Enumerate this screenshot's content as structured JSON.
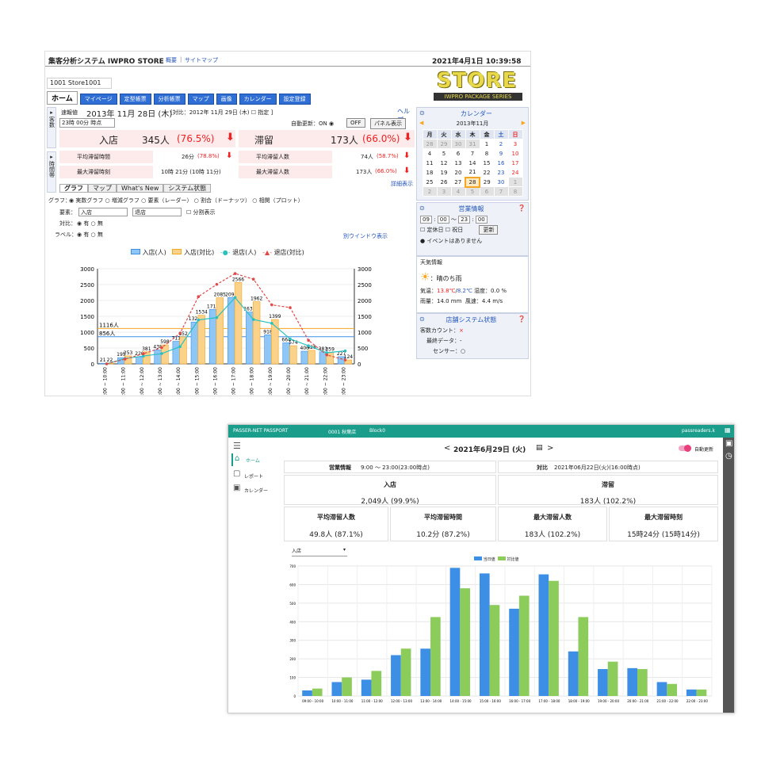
{
  "top": {
    "app_title": "集客分析システム IWPRO STORE",
    "link_overview": "概要",
    "link_sitemap": "サイトマップ",
    "datetime": "2021年4月1日 10:39:58",
    "logo_main": "STORE",
    "logo_sub": "IWPRO PACKAGE SERIES",
    "store_select": "1001 Store1001",
    "tabs": [
      "ホーム",
      "マイページ",
      "定型帳票",
      "分析帳票",
      "マップ",
      "画像",
      "カレンダー",
      "設定登録"
    ],
    "side_label_1": "客数",
    "side_label_2": "時間帯",
    "latest_label": "速報値",
    "date": "2013年 11月 28日 (木)",
    "compare": "[対比：2012年 11月 29日 (木) ☐ 指定 ]",
    "help": "ヘルプ",
    "time_select": "23時 00分 時点",
    "auto_update": "自動更新：ON ◉",
    "off_btn": "OFF",
    "panel_btn": "パネル表示",
    "entry_label": "入店",
    "entry_value": "345人",
    "entry_pct": "(76.5%)",
    "stay_label": "滞留",
    "stay_value": "173人",
    "stay_pct": "(66.0%)",
    "avg_stay_time_label": "平均滞留時間",
    "avg_stay_time": "26分",
    "avg_stay_time_pct": "(78.8%)",
    "avg_stay_count_label": "平均滞留人数",
    "avg_stay_count": "74人",
    "avg_stay_count_pct": "(58.7%)",
    "max_stay_time_label": "最大滞留時刻",
    "max_stay_time": "10時 21分 (10時 11分)",
    "max_stay_count_label": "最大滞留人数",
    "max_stay_count": "173人",
    "max_stay_count_pct": "(66.0%)",
    "detail_link": "詳細表示",
    "subtabs": [
      "グラフ",
      "マップ",
      "What's New",
      "システム状態"
    ],
    "graph_label": "グラフ：",
    "graph_options": "◉ 実数グラフ ○ 増減グラフ ○ 要素（レーダー） ○ 割合（ドーナッツ） ○ 相関（プロット）",
    "element_label": "要素：",
    "element_1": "入店",
    "element_2": "退店",
    "split_label": "☐ 分割表示",
    "compare_label": "対比：",
    "compare_options": "◉ 有 ○ 無",
    "label_label": "ラベル：",
    "label_options": "◉ 有 ○ 無",
    "new_window": "別ウインドウ表示",
    "calendar_title": "カレンダー",
    "calendar_month": "2013年11月",
    "calendar_days": [
      "月",
      "火",
      "水",
      "木",
      "金",
      "土",
      "日"
    ],
    "calendar_rows": [
      [
        "28",
        "29",
        "30",
        "31",
        "1",
        "2",
        "3"
      ],
      [
        "4",
        "5",
        "6",
        "7",
        "8",
        "9",
        "10"
      ],
      [
        "11",
        "12",
        "13",
        "14",
        "15",
        "16",
        "17"
      ],
      [
        "18",
        "19",
        "20",
        "21",
        "22",
        "23",
        "24"
      ],
      [
        "25",
        "26",
        "27",
        "28",
        "29",
        "30",
        "1"
      ],
      [
        "2",
        "3",
        "4",
        "5",
        "6",
        "7",
        "8"
      ]
    ],
    "biz_title": "営業情報",
    "biz_h1": "09",
    "biz_m1": "00",
    "biz_h2": "23",
    "biz_m2": "00",
    "holiday_label": "☐ 定休日 ☐ 祝日",
    "update_btn": "更新",
    "no_event": "● イベントはありません",
    "weather_title": "天気情報",
    "weather_desc": "：晴のち雨",
    "temp_label": "気温：",
    "temp_high": "13.8℃",
    "temp_low": "8.2℃",
    "humidity": "湿度：0.0 %",
    "rain": "雨量：14.0 mm",
    "wind": "風速：4.4 m/s",
    "sys_title": "店舗システム状態",
    "sys_count": "客数カウント：",
    "sys_count_val": "×",
    "sys_latest": "最終データ：-",
    "sys_sensor": "センサー：○"
  },
  "bottom": {
    "app_name": "PASSER-NET PASSPORT",
    "store": "0001 秋葉店",
    "block": "Block0",
    "user": "passreaders.k",
    "nav": [
      "ホーム",
      "レポート",
      "カレンダー"
    ],
    "date": "2021年6月29日 (火)",
    "auto_update": "自動更新",
    "biz_label": "営業情報",
    "biz_value": "9:00 ～ 23:00(23:00時点)",
    "compare_label": "対比",
    "compare_value": "2021年06月22日(火)(16:00時点)",
    "entry_label": "入店",
    "entry_value": "2,049人 (99.9%)",
    "stay_label": "滞留",
    "stay_value": "183人 (102.2%)",
    "avg_count_label": "平均滞留人数",
    "avg_count_value": "49.8人 (87.1%)",
    "avg_time_label": "平均滞留時間",
    "avg_time_value": "10.2分 (87.2%)",
    "max_count_label": "最大滞留人数",
    "max_count_value": "183人 (102.2%)",
    "max_time_label": "最大滞留時刻",
    "max_time_value": "15時24分 (15時14分)",
    "select_value": "入店"
  },
  "colors": {
    "blue": "#3d8fe6",
    "orange": "#f5a623",
    "teal": "#2ac0c0",
    "redline": "#e24848",
    "green": "#8bcc5b",
    "header": "#1b9d8c"
  },
  "chart_data": [
    {
      "type": "bar",
      "x": [
        "09:00 ~ 10:00",
        "10:00 ~ 11:00",
        "11:00 ~ 12:00",
        "12:00 ~ 13:00",
        "13:00 ~ 14:00",
        "14:00 ~ 15:00",
        "15:00 ~ 16:00",
        "16:00 ~ 17:00",
        "17:00 ~ 18:00",
        "18:00 ~ 19:00",
        "19:00 ~ 20:00",
        "20:00 ~ 21:00",
        "21:00 ~ 22:00",
        "22:00 ~ 23:00"
      ],
      "ylim": [
        0,
        3000
      ],
      "y_ticks": [
        0,
        500,
        1000,
        1500,
        2000,
        2500,
        3000
      ],
      "series": [
        {
          "name": "入店(人)",
          "type": "bar",
          "values": [
            21,
            195,
            220,
            438,
            711,
            1320,
            1715,
            2091,
            1635,
            918,
            664,
            400,
            381,
            227
          ]
        },
        {
          "name": "入店(対比)",
          "type": "bar",
          "values": [
            22,
            253,
            381,
            598,
            852,
            1534,
            2085,
            2566,
            1962,
            1399,
            574,
            428,
            359,
            124
          ]
        },
        {
          "name": "退店(人)",
          "type": "line",
          "values": [
            0,
            168,
            245,
            324,
            541,
            1384,
            1459,
            2091,
            1398,
            1279,
            787,
            570,
            351,
            409
          ]
        },
        {
          "name": "退店(対比)",
          "type": "line",
          "values": [
            0,
            150,
            320,
            512,
            962,
            2120,
            2506,
            2848,
            2671,
            1861,
            1774,
            742,
            281,
            124
          ]
        }
      ],
      "ref_lines": [
        {
          "label": "1116人",
          "value": 1116
        },
        {
          "label": "856人",
          "value": 856
        }
      ]
    },
    {
      "type": "bar",
      "x": [
        "09:00 - 10:00",
        "10:00 - 11:00",
        "11:00 - 12:00",
        "12:00 - 13:00",
        "13:00 - 14:00",
        "14:00 - 15:00",
        "15:00 - 16:00",
        "16:00 - 17:00",
        "17:00 - 18:00",
        "18:00 - 19:00",
        "19:00 - 20:00",
        "20:00 - 21:00",
        "21:00 - 22:00",
        "22:00 - 23:00"
      ],
      "ylim": [
        0,
        700
      ],
      "y_ticks": [
        0,
        100,
        200,
        300,
        400,
        500,
        600,
        700
      ],
      "series": [
        {
          "name": "当日値",
          "values": [
            30,
            75,
            88,
            220,
            255,
            690,
            660,
            470,
            655,
            240,
            145,
            150,
            75,
            35
          ]
        },
        {
          "name": "対比値",
          "values": [
            40,
            100,
            135,
            255,
            425,
            580,
            490,
            540,
            620,
            425,
            185,
            145,
            65,
            35
          ]
        }
      ]
    }
  ]
}
